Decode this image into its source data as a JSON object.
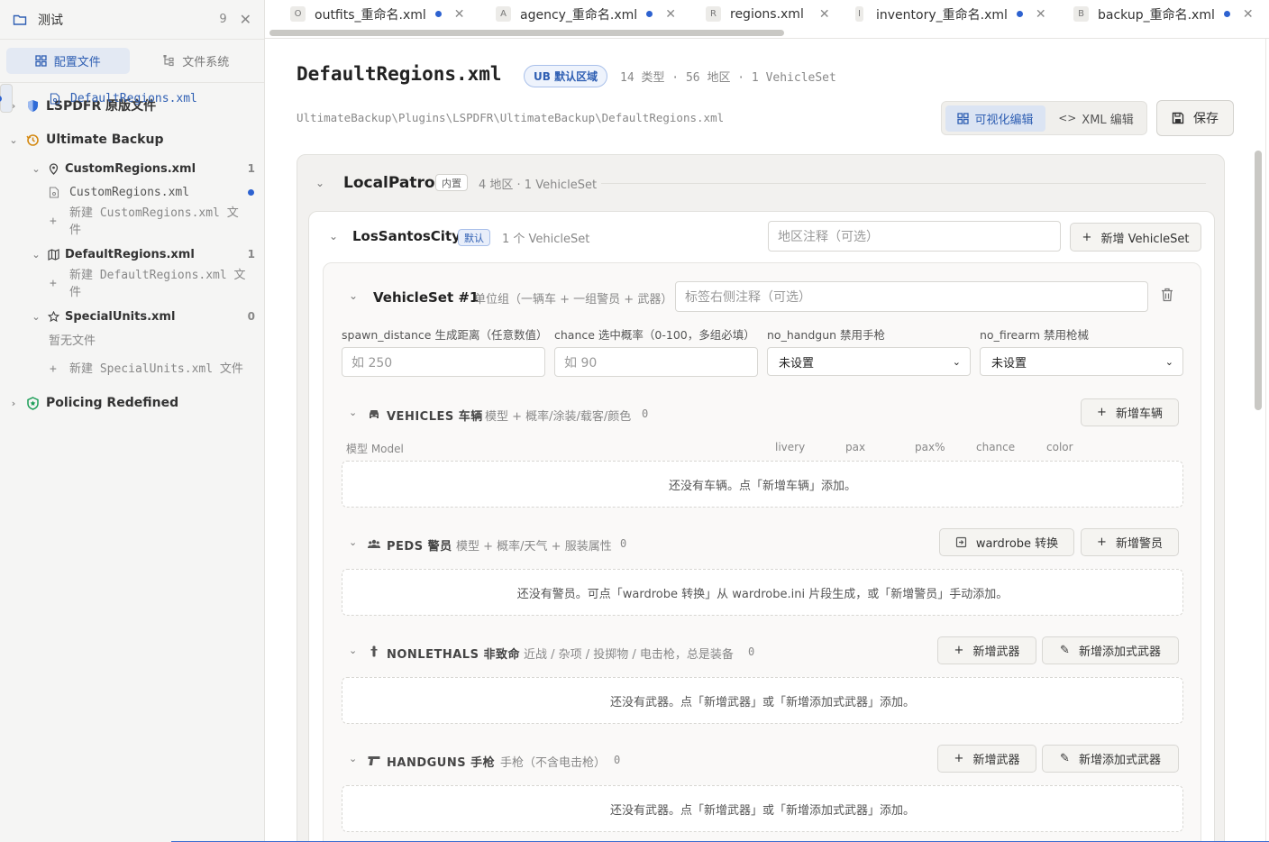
{
  "sidebar": {
    "workspace": "测试",
    "workspace_count": "9",
    "tabs": [
      "配置文件",
      "文件系统"
    ],
    "tree": {
      "lspdfr": "LSPDFR 原版文件",
      "ultimate": "Ultimate Backup",
      "custom_group": "CustomRegions.xml",
      "custom_group_count": "1",
      "custom_file": "CustomRegions.xml",
      "custom_new": "新建 CustomRegions.xml 文件",
      "default_group": "DefaultRegions.xml",
      "default_group_count": "1",
      "default_file": "DefaultRegions.xml",
      "default_new": "新建 DefaultRegions.xml 文件",
      "special_group": "SpecialUnits.xml",
      "special_group_count": "0",
      "special_empty": "暂无文件",
      "special_new": "新建 SpecialUnits.xml 文件",
      "policing": "Policing Redefined"
    }
  },
  "tabs": [
    {
      "letter": "O",
      "label": "outfits_重命名.xml",
      "dirty": true
    },
    {
      "letter": "A",
      "label": "agency_重命名.xml",
      "dirty": true
    },
    {
      "letter": "R",
      "label": "regions.xml",
      "dirty": false
    },
    {
      "letter": "I",
      "label": "inventory_重命名.xml",
      "dirty": true
    },
    {
      "letter": "B",
      "label": "backup_重命名.xml",
      "dirty": true
    }
  ],
  "header": {
    "title": "DefaultRegions.xml",
    "badge": "UB 默认区域",
    "meta": "14 类型 · 56 地区 · 1 VehicleSet",
    "path": "UltimateBackup\\Plugins\\LSPDFR\\UltimateBackup\\DefaultRegions.xml",
    "mode_visual": "可视化编辑",
    "mode_xml": "XML 编辑",
    "save": "保存"
  },
  "region": {
    "name": "LocalPatrol",
    "tag": "内置",
    "sub": "4 地区 · 1 VehicleSet"
  },
  "location": {
    "name": "LosSantosCity",
    "tag": "默认",
    "sub": "1 个 VehicleSet",
    "note_placeholder": "地区注释（可选）",
    "add_vehicleset": "新增 VehicleSet"
  },
  "vehicleset": {
    "title": "VehicleSet #1",
    "sub": "单位组（一辆车 + 一组警员 + 武器）",
    "note_placeholder": "标签右侧注释（可选）",
    "fields": {
      "spawn_label": "spawn_distance 生成距离（任意数值）",
      "spawn_placeholder": "如 250",
      "chance_label": "chance 选中概率（0-100，多组必填）",
      "chance_placeholder": "如 90",
      "handgun_label": "no_handgun 禁用手枪",
      "handgun_value": "未设置",
      "firearm_label": "no_firearm 禁用枪械",
      "firearm_value": "未设置"
    },
    "vehicles": {
      "title": "VEHICLES 车辆",
      "sub": "模型 + 概率/涂装/载客/颜色",
      "count": "0",
      "add": "新增车辆",
      "columns": [
        "模型 Model",
        "livery",
        "pax",
        "pax%",
        "chance",
        "color"
      ],
      "empty": "还没有车辆。点「新增车辆」添加。"
    },
    "peds": {
      "title": "PEDS 警员",
      "sub": "模型 + 概率/天气 + 服装属性",
      "count": "0",
      "convert": "wardrobe 转换",
      "add": "新增警员",
      "empty": "还没有警员。可点「wardrobe 转换」从 wardrobe.ini 片段生成，或「新增警员」手动添加。"
    },
    "nonlethals": {
      "title": "NONLETHALS 非致命",
      "sub": "近战 / 杂项 / 投掷物 / 电击枪，总是装备",
      "count": "0",
      "add": "新增武器",
      "add_attach": "新增添加式武器",
      "empty": "还没有武器。点「新增武器」或「新增添加式武器」添加。"
    },
    "handguns": {
      "title": "HANDGUNS 手枪",
      "sub": "手枪（不含电击枪）",
      "count": "0",
      "add": "新增武器",
      "add_attach": "新增添加式武器",
      "empty": "还没有武器。点「新增武器」或「新增添加式武器」添加。"
    }
  }
}
